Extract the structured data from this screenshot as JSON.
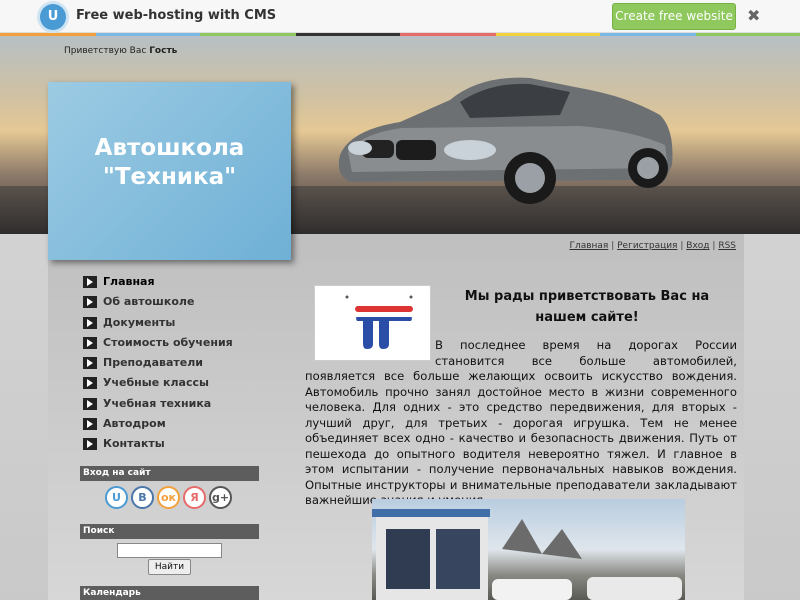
{
  "topbar": {
    "logo_letter": "U",
    "brand": "Free web-hosting with CMS",
    "create_button": "Create free website",
    "close_glyph": "✖"
  },
  "header": {
    "greeting_prefix": "Приветствую Вас",
    "greeting_user": "Гость",
    "site_title_line1": "Автошкола",
    "site_title_line2": "\"Техника\""
  },
  "toplinks": {
    "home": "Главная",
    "register": "Регистрация",
    "login": "Вход",
    "rss": "RSS",
    "separator": "|"
  },
  "menu": {
    "items": [
      {
        "label": "Главная"
      },
      {
        "label": "Об автошколе"
      },
      {
        "label": "Документы"
      },
      {
        "label": "Стоимость обучения"
      },
      {
        "label": "Преподаватели"
      },
      {
        "label": "Учебные классы"
      },
      {
        "label": "Учебная техника"
      },
      {
        "label": "Автодром"
      },
      {
        "label": "Контакты"
      }
    ]
  },
  "login_block": {
    "title": "Вход на сайт",
    "socials": [
      {
        "letter": "U",
        "color": "#4a9ad4"
      },
      {
        "letter": "В",
        "color": "#4a76a8"
      },
      {
        "letter": "ок",
        "color": "#f2a13d"
      },
      {
        "letter": "Я",
        "color": "#e86b6b"
      },
      {
        "letter": "g+",
        "color": "#555555"
      }
    ]
  },
  "search_block": {
    "title": "Поиск",
    "button": "Найти"
  },
  "calendar_block": {
    "title": "Календарь"
  },
  "content": {
    "heading": "Мы рады приветствовать Вас на нашем сайте!",
    "paragraph": "В последнее время на дорогах России становится все больше автомобилей, появляется все больше желающих освоить искусство вождения. Автомобиль прочно занял достойное место в жизни современного человека. Для одних - это средство передвижения, для вторых - лучший друг, для третьих - дорогая игрушка. Тем не менее объединяет всех одно - качество и безопасность движения. Путь от пешехода до опытного водителя невероятно тяжел. И главное в этом испытании - получение первоначальных навыков вождения. Опытные инструкторы и внимательные преподаватели закладывают важнейшие знания и умения."
  },
  "colors": {
    "accent_blue": "#6fb0d6",
    "create_green": "#8fc85c",
    "block_title_bg": "#5d5d5d"
  }
}
